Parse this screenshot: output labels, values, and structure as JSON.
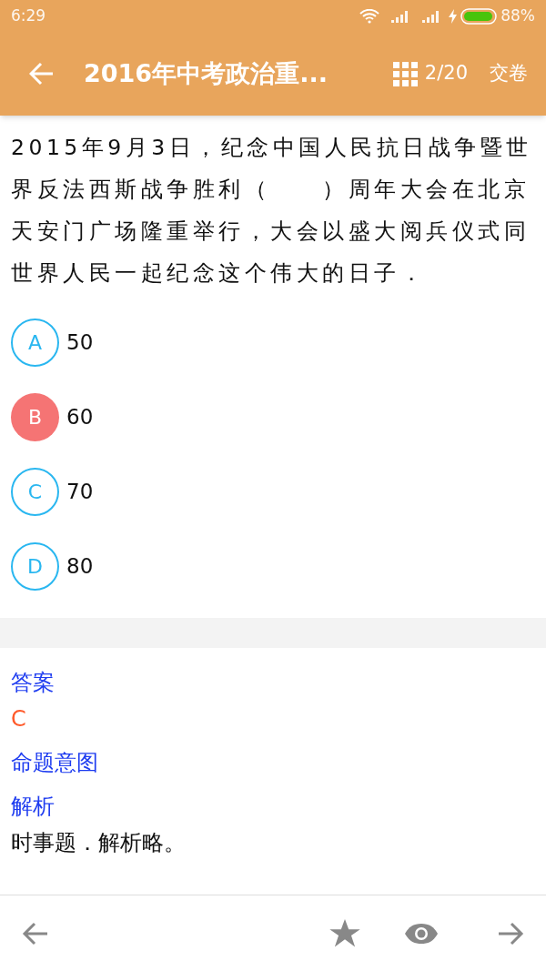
{
  "status_bar": {
    "time": "6:29",
    "battery": "88%"
  },
  "toolbar": {
    "title": "2016年中考政治重...",
    "progress": "2/20",
    "submit": "交卷"
  },
  "question": {
    "text": "2015年9月3日，纪念中国人民抗日战争暨世界反法西斯战争胜利（　　）周年大会在北京天安门广场隆重举行，大会以盛大阅兵仪式同世界人民一起纪念这个伟大的日子．"
  },
  "options": [
    {
      "letter": "A",
      "text": "50",
      "selected": false
    },
    {
      "letter": "B",
      "text": "60",
      "selected": true
    },
    {
      "letter": "C",
      "text": "70",
      "selected": false
    },
    {
      "letter": "D",
      "text": "80",
      "selected": false
    }
  ],
  "analysis": [
    {
      "kind": "heading",
      "text": "答案"
    },
    {
      "kind": "answer",
      "text": "C"
    },
    {
      "kind": "heading",
      "text": "命题意图"
    },
    {
      "kind": "heading",
      "text": "解析"
    },
    {
      "kind": "body",
      "text": "时事题．解析略。"
    }
  ]
}
